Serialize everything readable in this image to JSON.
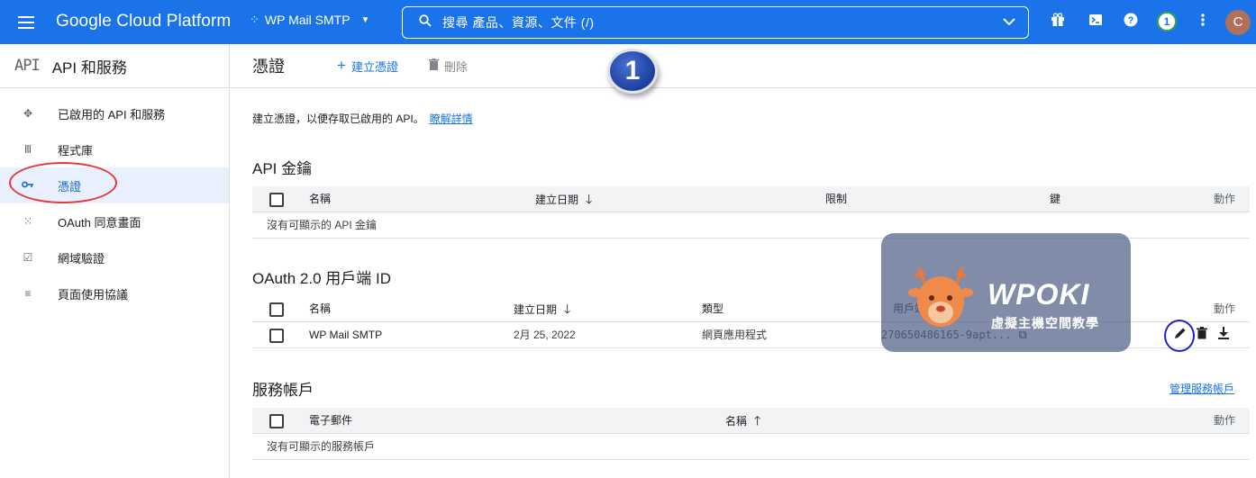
{
  "topbar": {
    "brand": "Google Cloud Platform",
    "project_icon": "project-dots-icon",
    "project_name": "WP Mail SMTP",
    "search_placeholder": "搜尋  產品、資源、文件 (/)",
    "notification_count": "1",
    "avatar_letter": "C",
    "colors": {
      "bar": "#1a73e8"
    }
  },
  "sidebar": {
    "logo": "API",
    "title": "API 和服務",
    "items": [
      {
        "label": "已啟用的 API 和服務",
        "icon": "api-diamond-icon"
      },
      {
        "label": "程式庫",
        "icon": "library-icon"
      },
      {
        "label": "憑證",
        "icon": "key-icon",
        "active": true
      },
      {
        "label": "OAuth 同意畫面",
        "icon": "oauth-dots-icon"
      },
      {
        "label": "網域驗證",
        "icon": "domain-check-icon"
      },
      {
        "label": "頁面使用協議",
        "icon": "settings-list-icon"
      }
    ]
  },
  "header": {
    "title": "憑證",
    "create_label": "建立憑證",
    "delete_label": "刪除",
    "step_badge": "1"
  },
  "intro": {
    "text": "建立憑證，以便存取已啟用的 API。",
    "link": "瞭解詳情"
  },
  "api_keys": {
    "title": "API 金鑰",
    "headers": {
      "name": "名稱",
      "created": "建立日期",
      "restrictions": "限制",
      "key": "鍵",
      "actions": "動作"
    },
    "empty": "沒有可顯示的 API 金鑰"
  },
  "oauth": {
    "title": "OAuth 2.0 用戶端 ID",
    "headers": {
      "name": "名稱",
      "created": "建立日期",
      "type": "類型",
      "client_id": "用戶端編號",
      "actions": "動作"
    },
    "rows": [
      {
        "name": "WP Mail SMTP",
        "created": "2月 25, 2022",
        "type": "網頁應用程式",
        "client_id": "270650486165-9apt..."
      }
    ]
  },
  "service_accounts": {
    "title": "服務帳戶",
    "manage_link": "管理服務帳戶",
    "headers": {
      "email": "電子郵件",
      "name": "名稱",
      "actions": "動作"
    },
    "empty": "沒有可顯示的服務帳戶"
  },
  "watermark": {
    "title": "WPOKI",
    "subtitle": "虛擬主機空間教學"
  }
}
